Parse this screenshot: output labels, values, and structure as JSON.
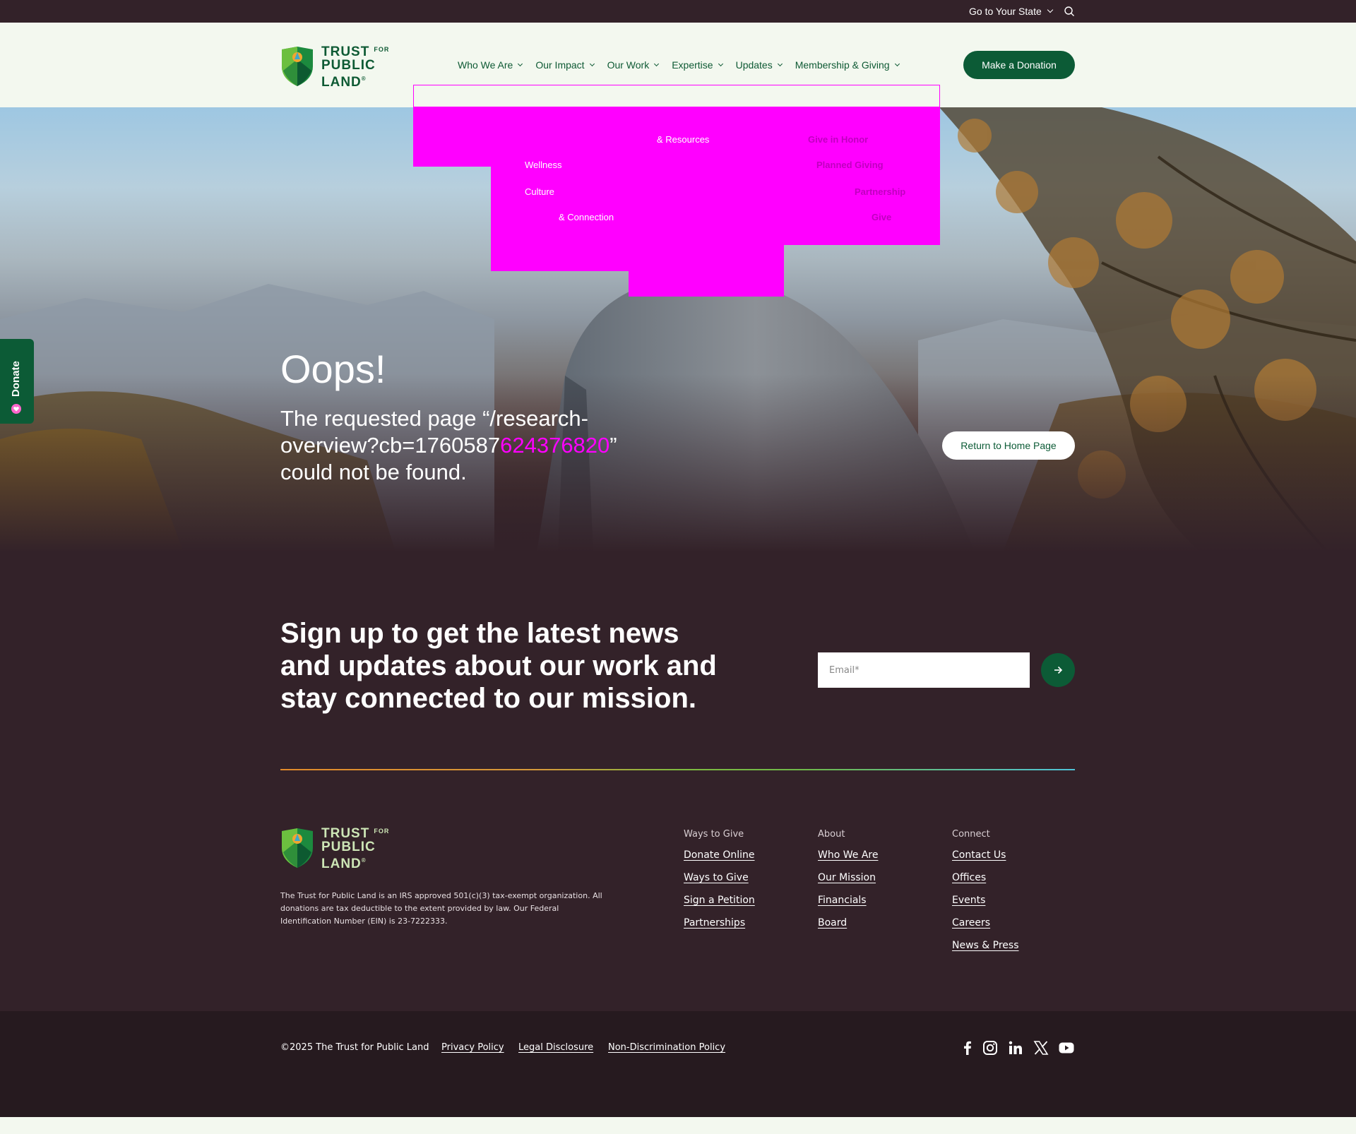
{
  "utility": {
    "state_link": "Go to Your State"
  },
  "header": {
    "logo": {
      "line1": "TRUST",
      "for": "FOR",
      "line2": "PUBLIC",
      "line3": "LAND",
      "reg": "®"
    },
    "nav": [
      {
        "label": "Who We Are"
      },
      {
        "label": "Our Impact"
      },
      {
        "label": "Our Work"
      },
      {
        "label": "Expertise"
      },
      {
        "label": "Updates"
      },
      {
        "label": "Membership & Giving"
      }
    ],
    "donate_button": "Make a Donation"
  },
  "dropdown_fragments": [
    "& Resources",
    "Give in Honor",
    "Planned Giving",
    "Partnership",
    "Wellness",
    "Culture",
    "& Connection",
    "Give"
  ],
  "hero": {
    "title": "Oops!",
    "message_prefix": "The requested page “/research-overview?cb=176058",
    "message_tail": "7",
    "message_glitch": "6243",
    "message_glitch2": "76820",
    "message_suffix": "” could not be found.",
    "home_button": "Return to Home Page"
  },
  "side_tab": {
    "label": "Donate"
  },
  "signup": {
    "title": "Sign up to get the latest news and updates about our work and stay connected to our mission.",
    "email_placeholder": "Email*"
  },
  "footer": {
    "legal": "The Trust for Public Land is an IRS approved 501(c)(3) tax-exempt organization. All donations are tax deductible to the extent provided by law. Our Federal Identification Number (EIN) is 23-7222333.",
    "columns": [
      {
        "heading": "Ways to Give",
        "links": [
          "Donate Online",
          "Ways to Give",
          "Sign a Petition",
          "Partnerships"
        ]
      },
      {
        "heading": "About",
        "links": [
          "Who We Are",
          "Our Mission",
          "Financials",
          "Board"
        ]
      },
      {
        "heading": "Connect",
        "links": [
          "Contact Us",
          "Offices",
          "Events",
          "Careers",
          "News & Press"
        ]
      }
    ]
  },
  "bottom": {
    "copyright": "©2025 The Trust for Public Land",
    "links": [
      "Privacy Policy",
      "Legal Disclosure",
      "Non-Discrimination Policy"
    ],
    "social_icons": [
      "facebook-icon",
      "instagram-icon",
      "linkedin-icon",
      "x-icon",
      "youtube-icon"
    ]
  },
  "colors": {
    "brand_green": "#0c5b36",
    "dark_plum": "#332229",
    "header_bg": "#f3f8ef",
    "glitch": "#ff00ff"
  }
}
